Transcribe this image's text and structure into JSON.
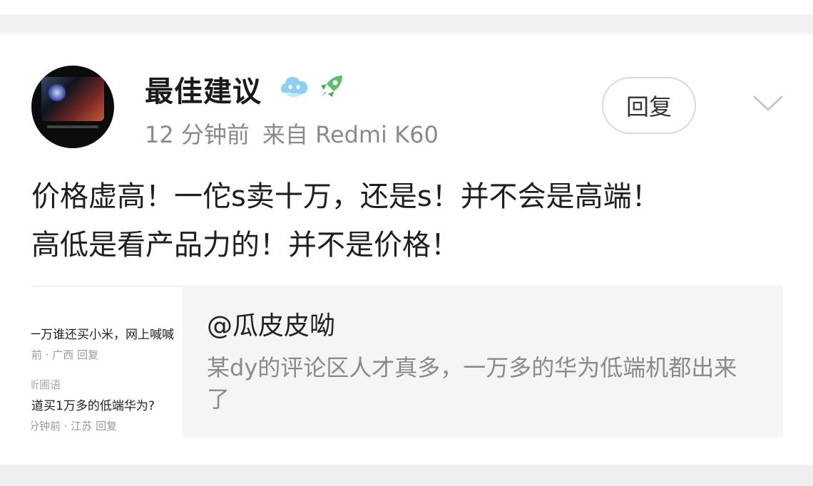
{
  "post": {
    "username": "最佳建议",
    "time": "12 分钟前",
    "source": "来自 Redmi K60",
    "reply_label": "回复",
    "content_lines": [
      "价格虚高！一佗s卖十万，还是s！并不会是高端！",
      "高低是看产品力的！并不是价格！"
    ]
  },
  "quote": {
    "user": "@瓜皮皮呦",
    "text": "某dy的评论区人才真多，一万多的华为低端机都出来了",
    "thumbnail_lines": [
      "一万谁还买小米，网上喊喊",
      "前 · 广西    回复",
      "昕圃语",
      "道买1万多的低端华为?",
      "分钟前 · 江苏    回复"
    ]
  },
  "icons": {
    "badge1": "cloud-mascot-icon",
    "badge2": "rocket-icon",
    "menu": "chevron-down-icon"
  },
  "colors": {
    "badge_cloud": "#8fd0f0",
    "badge_rocket": "#5cc06a",
    "secondary_text": "#8a8a8a"
  }
}
